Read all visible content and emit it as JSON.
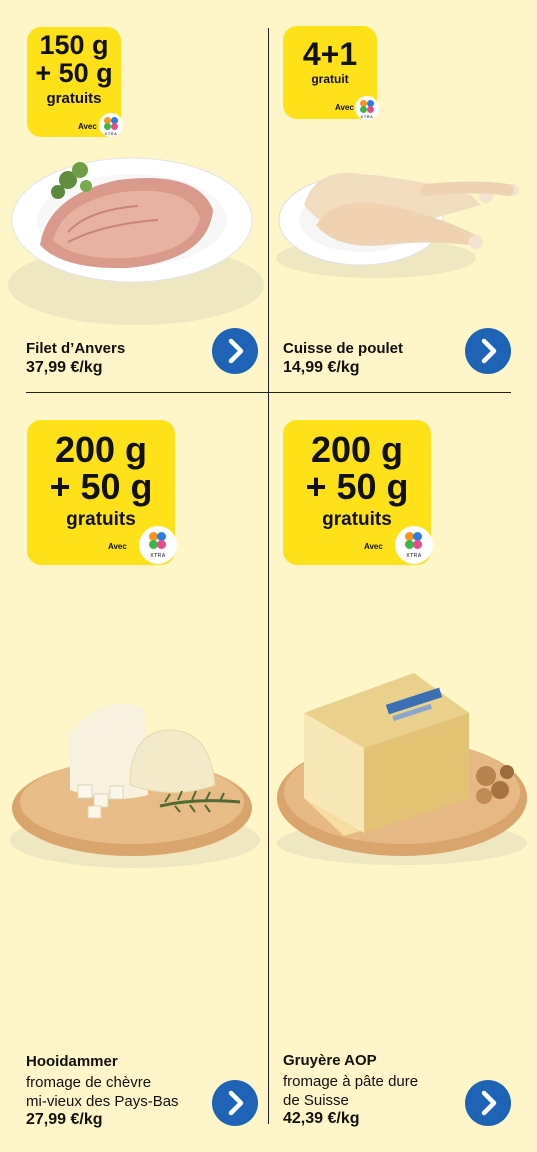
{
  "products": [
    {
      "promo_line1": "150 g",
      "promo_line2": "+ 50 g",
      "promo_line3": "gratuits",
      "promo_avec": "Avec",
      "xtra_label": "XTRA",
      "name": "Filet d’Anvers",
      "description": "",
      "price": "37,99 €/kg",
      "image_icon": "sliced-ham-plate-image"
    },
    {
      "promo_line1": "4+1",
      "promo_line2": "gratuit",
      "promo_avec": "Avec",
      "xtra_label": "XTRA",
      "name": "Cuisse de poulet",
      "description": "",
      "price": "14,99 €/kg",
      "image_icon": "chicken-legs-plate-image"
    },
    {
      "promo_line1": "200 g",
      "promo_line2": "+ 50 g",
      "promo_line3": "gratuits",
      "promo_avec": "Avec",
      "xtra_label": "XTRA",
      "name": "Hooidammer",
      "description_line1": "fromage de chèvre",
      "description_line2": "mi-vieux des Pays-Bas",
      "price": "27,99 €/kg",
      "image_icon": "goat-cheese-board-image"
    },
    {
      "promo_line1": "200 g",
      "promo_line2": "+ 50 g",
      "promo_line3": "gratuits",
      "promo_avec": "Avec",
      "xtra_label": "XTRA",
      "name": "Gruyère AOP",
      "description_line1": "fromage à pâte dure",
      "description_line2": "de Suisse",
      "price": "42,39 €/kg",
      "image_icon": "gruyere-cheese-board-image"
    }
  ],
  "colors": {
    "background": "#FEF5C8",
    "promo": "#FFE11A",
    "arrow_button": "#1F63B7",
    "divider": "#222222"
  },
  "icons": {
    "arrow": "chevron-right-icon",
    "loyalty": "xtra-logo-icon"
  }
}
